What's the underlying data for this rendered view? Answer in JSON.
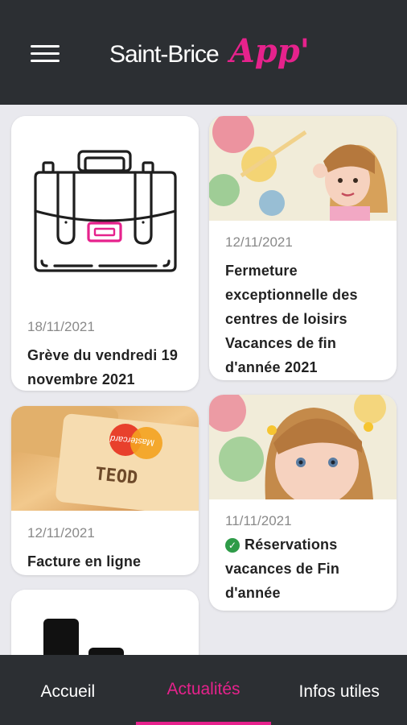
{
  "header": {
    "city_name": "Saint-Brice",
    "app_name": "App'",
    "menu_icon": "hamburger-icon"
  },
  "colors": {
    "accent": "#e6228c",
    "bar_background": "#2c2f33",
    "feed_background": "#e9e9ee",
    "card_background": "#ffffff",
    "success": "#2e9b48"
  },
  "news": [
    {
      "date": "18/11/2021",
      "title": "Grève du vendredi 19 novembre 2021",
      "image": "briefcase-illustration"
    },
    {
      "date": "12/11/2021",
      "title": "Fermeture exceptionnelle des centres de loisirs Vacances de fin d'année 2021",
      "image": "girl-painting-photo"
    },
    {
      "date": "12/11/2021",
      "title": "Facture en ligne",
      "image": "credit-cards-photo"
    },
    {
      "date": "11/11/2021",
      "title": "Réservations vacances de Fin d'année",
      "image": "girl-painting-photo-closeup",
      "status_icon": "check-circle-icon"
    },
    {
      "image": "bar-chart-illustration"
    }
  ],
  "bottom_nav": {
    "items": [
      {
        "label": "Accueil"
      },
      {
        "label": "Actualités",
        "active": true
      },
      {
        "label": "Infos utiles"
      }
    ]
  }
}
